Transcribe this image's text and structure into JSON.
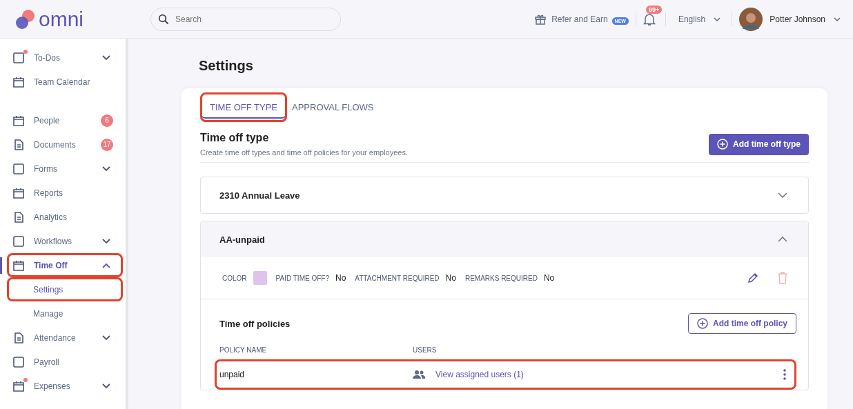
{
  "header": {
    "logo": "omni",
    "search": {
      "placeholder": "Search"
    },
    "refer": "Refer and Earn",
    "refer_badge": "NEW",
    "notifications": "99+",
    "language": "English",
    "user": "Potter Johnson"
  },
  "sidebar": {
    "sections": [
      [
        {
          "label": "To-Dos",
          "dot": true,
          "expanded": false,
          "selected": false
        },
        {
          "label": "Team Calendar",
          "selected": false
        }
      ],
      [
        {
          "label": "People",
          "badge": "6",
          "selected": false
        },
        {
          "label": "Documents",
          "badge": "17",
          "selected": false
        },
        {
          "label": "Forms",
          "expanded": false,
          "selected": false
        },
        {
          "label": "Reports",
          "selected": false
        },
        {
          "label": "Analytics",
          "selected": false
        },
        {
          "label": "Workflows",
          "expanded": false,
          "selected": false
        },
        {
          "label": "Time Off",
          "expanded": true,
          "selected": true,
          "highlighted": true,
          "children": [
            {
              "label": "Settings",
              "selected": true,
              "highlighted": true
            },
            {
              "label": "Manage",
              "selected": false
            }
          ]
        },
        {
          "label": "Attendance",
          "expanded": false,
          "selected": false
        },
        {
          "label": "Payroll",
          "selected": false
        },
        {
          "label": "Expenses",
          "dot": true,
          "expanded": false,
          "selected": false
        }
      ]
    ]
  },
  "page_title": "Settings",
  "tabs": [
    {
      "label": "TIME OFF TYPE",
      "selected": true,
      "highlighted": true
    },
    {
      "label": "APPROVAL FLOWS",
      "selected": false
    }
  ],
  "section": {
    "title": "Time off type",
    "subtitle": "Create time off types and time off policies for your employees.",
    "add_button": "Add time off type"
  },
  "types": [
    {
      "name": "2310 Annual Leave",
      "expanded": false
    },
    {
      "name": "AA-unpaid",
      "expanded": true,
      "color": "#e0c3ea",
      "fields": [
        {
          "label": "COLOR"
        },
        {
          "label": "PAID TIME OFF?",
          "value": "No"
        },
        {
          "label": "ATTACHMENT REQUIRED",
          "value": "No"
        },
        {
          "label": "REMARKS REQUIRED",
          "value": "No"
        }
      ],
      "policies": {
        "title": "Time off policies",
        "add_button": "Add time off policy",
        "columns": [
          "POLICY NAME",
          "USERS"
        ],
        "rows": [
          {
            "name": "unpaid",
            "users": "View assigned users (1)",
            "highlighted": true
          }
        ]
      }
    }
  ]
}
